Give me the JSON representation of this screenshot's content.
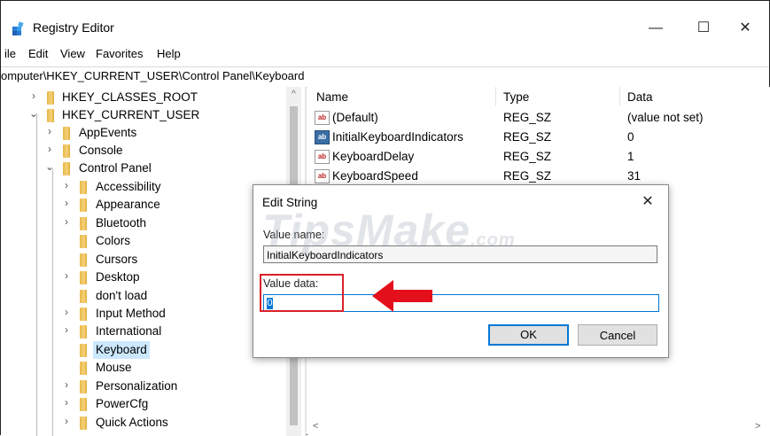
{
  "window": {
    "title": "Registry Editor",
    "minimize": "—",
    "maximize": "☐",
    "close": "✕"
  },
  "menu": {
    "items": [
      "ile",
      "Edit",
      "View",
      "Favorites",
      "Help"
    ]
  },
  "address": {
    "path": "omputer\\HKEY_CURRENT_USER\\Control Panel\\Keyboard"
  },
  "tree": {
    "items": [
      {
        "label": "HKEY_CLASSES_ROOT",
        "chevron": "›"
      },
      {
        "label": "HKEY_CURRENT_USER",
        "chevron": "⌄"
      },
      {
        "label": "AppEvents",
        "chevron": "›"
      },
      {
        "label": "Console",
        "chevron": "›"
      },
      {
        "label": "Control Panel",
        "chevron": "⌄"
      },
      {
        "label": "Accessibility",
        "chevron": "›"
      },
      {
        "label": "Appearance",
        "chevron": "›"
      },
      {
        "label": "Bluetooth",
        "chevron": "›"
      },
      {
        "label": "Colors",
        "chevron": ""
      },
      {
        "label": "Cursors",
        "chevron": ""
      },
      {
        "label": "Desktop",
        "chevron": "›"
      },
      {
        "label": "don't load",
        "chevron": ""
      },
      {
        "label": "Input Method",
        "chevron": "›"
      },
      {
        "label": "International",
        "chevron": "›"
      },
      {
        "label": "Keyboard",
        "chevron": ""
      },
      {
        "label": "Mouse",
        "chevron": ""
      },
      {
        "label": "Personalization",
        "chevron": "›"
      },
      {
        "label": "PowerCfg",
        "chevron": "›"
      },
      {
        "label": "Quick Actions",
        "chevron": "›"
      }
    ],
    "scroll_up": "^"
  },
  "list": {
    "headers": {
      "name": "Name",
      "type": "Type",
      "data": "Data"
    },
    "rows": [
      {
        "icon": "ab",
        "name": "(Default)",
        "type": "REG_SZ",
        "data": "(value not set)"
      },
      {
        "icon": "ab",
        "name": "InitialKeyboardIndicators",
        "type": "REG_SZ",
        "data": "0"
      },
      {
        "icon": "ab",
        "name": "KeyboardDelay",
        "type": "REG_SZ",
        "data": "1"
      },
      {
        "icon": "ab",
        "name": "KeyboardSpeed",
        "type": "REG_SZ",
        "data": "31"
      }
    ],
    "scroll_left": "<",
    "scroll_right": ">"
  },
  "dialog": {
    "title": "Edit String",
    "close": "✕",
    "value_name_label": "Value name:",
    "value_name": "InitialKeyboardIndicators",
    "value_data_label": "Value data:",
    "value_data": "0",
    "ok_label": "OK",
    "cancel_label": "Cancel"
  },
  "watermark": {
    "text": "TipsMake",
    "suffix": ".com"
  },
  "colors": {
    "accent": "#0078d7",
    "highlight": "#d9202a",
    "selection": "#cce8ff"
  }
}
